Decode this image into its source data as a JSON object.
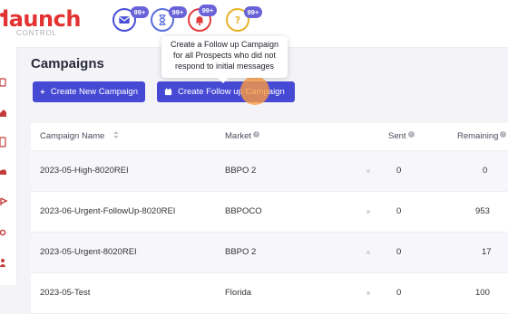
{
  "logo": {
    "word": "launch",
    "sub": "CONTROL"
  },
  "notifications": [
    {
      "icon": "envelope-icon",
      "count": "99+",
      "color": "#4a4fd6"
    },
    {
      "icon": "hourglass-icon",
      "count": "99+",
      "color": "#5a6ed8"
    },
    {
      "icon": "bell-icon",
      "count": "99+",
      "color": "#e23b3b"
    },
    {
      "icon": "question-icon",
      "count": "99+",
      "color": "#e7b228"
    }
  ],
  "page": {
    "title": "Campaigns"
  },
  "buttons": {
    "create_new": "Create New Campaign",
    "create_follow_up": "Create Follow up Campaign"
  },
  "tooltip": {
    "text": "Create a Follow up Campaign for all Prospects who did not respond to initial messages"
  },
  "table": {
    "columns": [
      "Campaign Name",
      "Market",
      "Sent",
      "Remaining"
    ],
    "rows": [
      {
        "name": "2023-05-High-8020REI",
        "market": "BBPO 2",
        "sent": "0",
        "remaining": "0"
      },
      {
        "name": "2023-06-Urgent-FollowUp-8020REI",
        "market": "BBPOCO",
        "sent": "0",
        "remaining": "953"
      },
      {
        "name": "2023-05-Urgent-8020REI",
        "market": "BBPO 2",
        "sent": "0",
        "remaining": "17"
      },
      {
        "name": "2023-05-Test",
        "market": "Florida",
        "sent": "0",
        "remaining": "100"
      }
    ]
  },
  "colors": {
    "brand": "#e23232",
    "primary": "#4649d4",
    "badge": "#6a63d8",
    "click": "#ff9a3c"
  }
}
